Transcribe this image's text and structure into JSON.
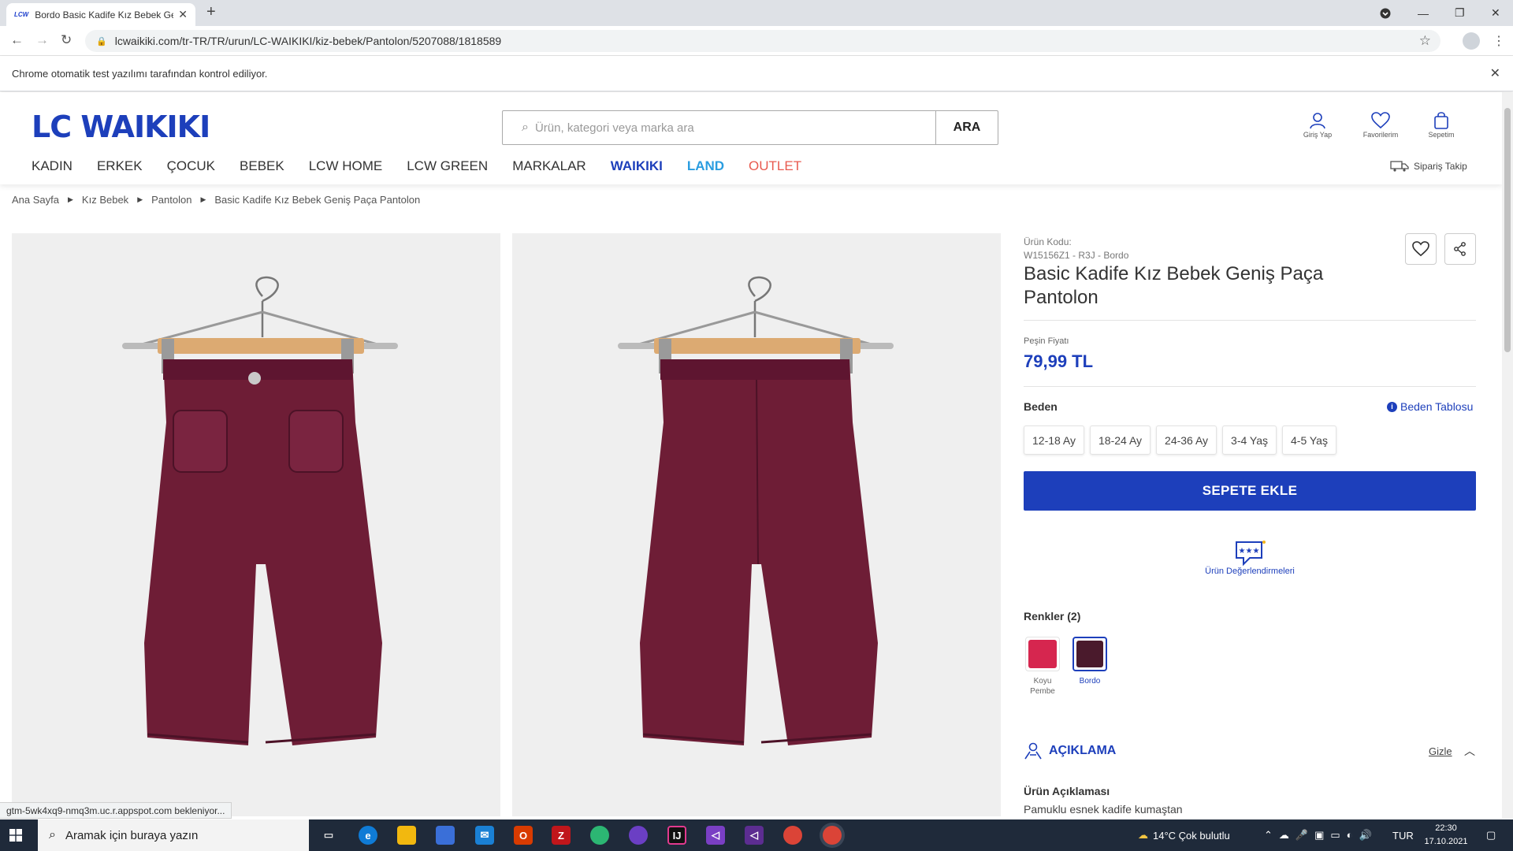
{
  "browser": {
    "tab_title": "Bordo Basic Kadife Kız Bebek Ge",
    "tab_favicon": "LCW",
    "url": "lcwaikiki.com/tr-TR/TR/urun/LC-WAIKIKI/kiz-bebek/Pantolon/5207088/1818589",
    "automation_notice": "Chrome otomatik test yazılımı tarafından kontrol ediliyor.",
    "status_text": "gtm-5wk4xq9-nmq3m.uc.r.appspot.com bekleniyor..."
  },
  "header": {
    "logo": "LC WAIKIKI",
    "search_placeholder": "Ürün, kategori veya marka ara",
    "search_button": "ARA",
    "icons": [
      {
        "icon": "user-icon",
        "label": "Giriş Yap"
      },
      {
        "icon": "heart-icon",
        "label": "Favorilerim"
      },
      {
        "icon": "bag-icon",
        "label": "Sepetim"
      }
    ],
    "nav": [
      "KADIN",
      "ERKEK",
      "ÇOCUK",
      "BEBEK",
      "LCW HOME",
      "LCW GREEN",
      "MARKALAR"
    ],
    "nav_waikiki_a": "WAIKIKI",
    "nav_waikiki_b": "LAND",
    "nav_outlet": "OUTLET",
    "order_tracking": "Sipariş Takip"
  },
  "breadcrumb": [
    "Ana Sayfa",
    "Kız Bebek",
    "Pantolon",
    "Basic Kadife Kız Bebek Geniş Paça Pantolon"
  ],
  "product": {
    "code_label": "Ürün Kodu:",
    "code_value": "W15156Z1 - R3J - Bordo",
    "title": "Basic Kadife Kız Bebek Geniş Paça Pantolon",
    "price_label": "Peşin Fiyatı",
    "price": "79,99 TL",
    "size_label": "Beden",
    "size_chart": "Beden Tablosu",
    "sizes": [
      "12-18 Ay",
      "18-24 Ay",
      "24-36 Ay",
      "3-4 Yaş",
      "4-5 Yaş"
    ],
    "add_to_cart": "SEPETE EKLE",
    "reviews_label": "Ürün Değerlendirmeleri",
    "colors_label": "Renkler (2)",
    "colors": [
      {
        "label_1": "Koyu",
        "label_2": "Pembe",
        "hex": "#d6264f",
        "selected": false
      },
      {
        "label_1": "Bordo",
        "label_2": "",
        "hex": "#4a1a2c",
        "selected": true
      }
    ],
    "description_header": "AÇIKLAMA",
    "hide_label": "Gizle",
    "description_title": "Ürün Açıklaması",
    "description_text": "Pamuklu esnek kadife kumaştan"
  },
  "taskbar": {
    "search_placeholder": "Aramak için buraya yazın",
    "weather": "14°C  Çok bulutlu",
    "lang": "TUR",
    "time": "22:30",
    "date": "17.10.2021"
  },
  "colors": {
    "brand_blue": "#1d3fbb",
    "land_blue": "#2a9de0",
    "outlet_red": "#e85a4f",
    "pants_color": "#6e1d36"
  }
}
